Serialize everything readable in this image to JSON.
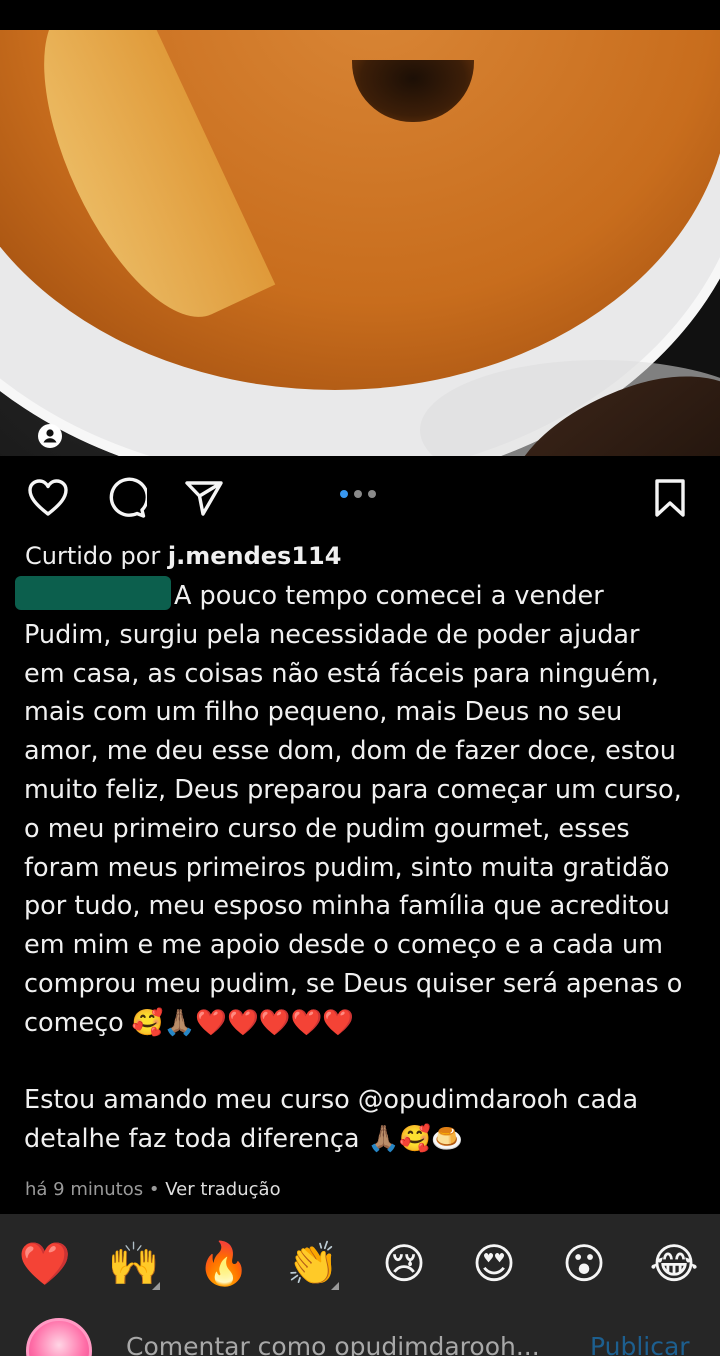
{
  "post": {
    "liked_by_prefix": "Curtido por ",
    "liked_by_user": "j.mendes114",
    "caption": "A pouco tempo comecei a vender\nPudim, surgiu pela necessidade de poder ajudar\nem casa, as coisas não está fáceis para ninguém,\nmais com um filho pequeno, mais Deus no seu\namor, me deu esse dom, dom de fazer doce, estou\nmuito feliz, Deus preparou para começar um curso,\no meu primeiro curso de pudim gourmet, esses\nforam meus primeiros pudim, sinto muita gratidão\npor tudo, meu esposo minha família que acreditou\nem mim e me apoio desde o começo e a cada um\ncomprou meu pudim, se Deus quiser será apenas o\ncomeço 🥰🙏🏽❤️❤️❤️❤️❤️\n\nEstou amando meu curso @opudimdarooh cada\ndetalhe faz toda diferença 🙏🏽🥰🍮",
    "time": "há 9 minutos",
    "separator": " • ",
    "translate": "Ver tradução"
  },
  "icons": {
    "like": "heart-icon",
    "comment": "comment-icon",
    "share": "send-icon",
    "save": "bookmark-icon",
    "tag": "user-tag-icon"
  },
  "carousel": {
    "count": 3,
    "active": 1
  },
  "reactions": [
    "❤️",
    "🙌",
    "🔥",
    "👏",
    "😢",
    "😍",
    "😮",
    "😂"
  ],
  "comment_bar": {
    "placeholder": "Comentar como opudimdarooh...",
    "publish": "Publicar"
  },
  "colors": {
    "background": "#000000",
    "reaction_bar": "#262626",
    "carousel_active": "#3897f0",
    "publish": "#1d5f8f"
  }
}
